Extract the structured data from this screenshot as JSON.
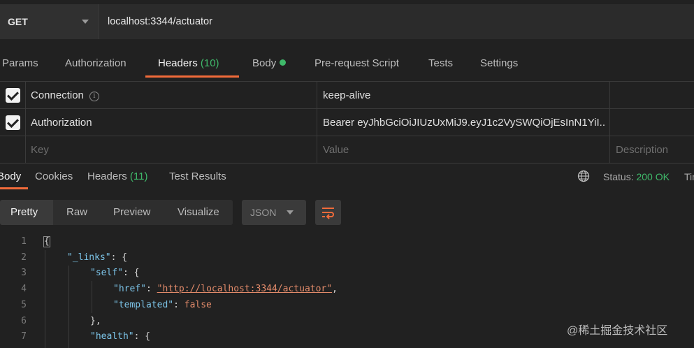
{
  "request": {
    "method": "GET",
    "url": "localhost:3344/actuator"
  },
  "request_tabs": [
    {
      "label": "Params"
    },
    {
      "label": "Authorization"
    },
    {
      "label": "Headers",
      "count": "(10)"
    },
    {
      "label": "Body"
    },
    {
      "label": "Pre-request Script"
    },
    {
      "label": "Tests"
    },
    {
      "label": "Settings"
    }
  ],
  "headers_table": {
    "rows": [
      {
        "key": "Connection",
        "value": "keep-alive"
      },
      {
        "key": "Authorization",
        "value": "Bearer eyJhbGciOiJIUzUxMiJ9.eyJ1c2VySWQiOjEsInN1YiI..."
      }
    ],
    "placeholders": {
      "key": "Key",
      "value": "Value",
      "description": "Description"
    }
  },
  "response_tabs": [
    {
      "label": "Body"
    },
    {
      "label": "Cookies"
    },
    {
      "label": "Headers",
      "count": "(11)"
    },
    {
      "label": "Test Results"
    }
  ],
  "status": {
    "label": "Status:",
    "value": "200 OK",
    "time_label": "Tim"
  },
  "view_modes": [
    "Pretty",
    "Raw",
    "Preview",
    "Visualize"
  ],
  "format_select": "JSON",
  "code_lines": [
    {
      "n": "1"
    },
    {
      "n": "2",
      "key": "\"_links\"",
      "rest": ": {"
    },
    {
      "n": "3",
      "key": "\"self\"",
      "rest": ": {"
    },
    {
      "n": "4",
      "key": "\"href\"",
      "sep": ": ",
      "val": "\"http://localhost:3344/actuator\"",
      "tail": ","
    },
    {
      "n": "5",
      "key": "\"templated\"",
      "sep": ": ",
      "val": "false"
    },
    {
      "n": "6",
      "text": "},"
    },
    {
      "n": "7",
      "key": "\"health\"",
      "rest": ": {"
    }
  ],
  "code_first_brace": "{",
  "watermark": "@稀土掘金技术社区",
  "colors": {
    "accent": "#f26b3a",
    "success": "#3fb96a",
    "background": "#212121"
  },
  "icons": [
    "chevron-down-icon",
    "info-icon",
    "checkbox-checked-icon",
    "globe-icon",
    "wrap-lines-icon"
  ]
}
